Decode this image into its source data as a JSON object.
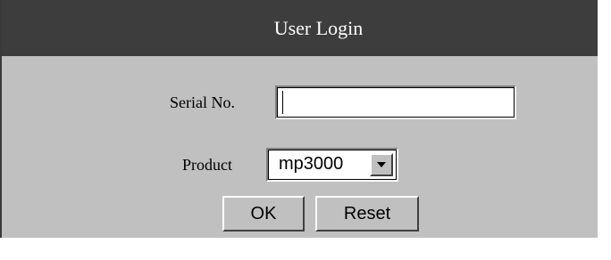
{
  "dialog": {
    "title": "User Login"
  },
  "form": {
    "serial": {
      "label": "Serial No.",
      "value": "",
      "placeholder": ""
    },
    "product": {
      "label": "Product",
      "selected": "mp3000"
    }
  },
  "buttons": {
    "ok_label": "OK",
    "reset_label": "Reset"
  },
  "colors": {
    "titlebar": "#3d3d3d",
    "panel": "#c0c0c0",
    "title_text": "#ffffff"
  }
}
